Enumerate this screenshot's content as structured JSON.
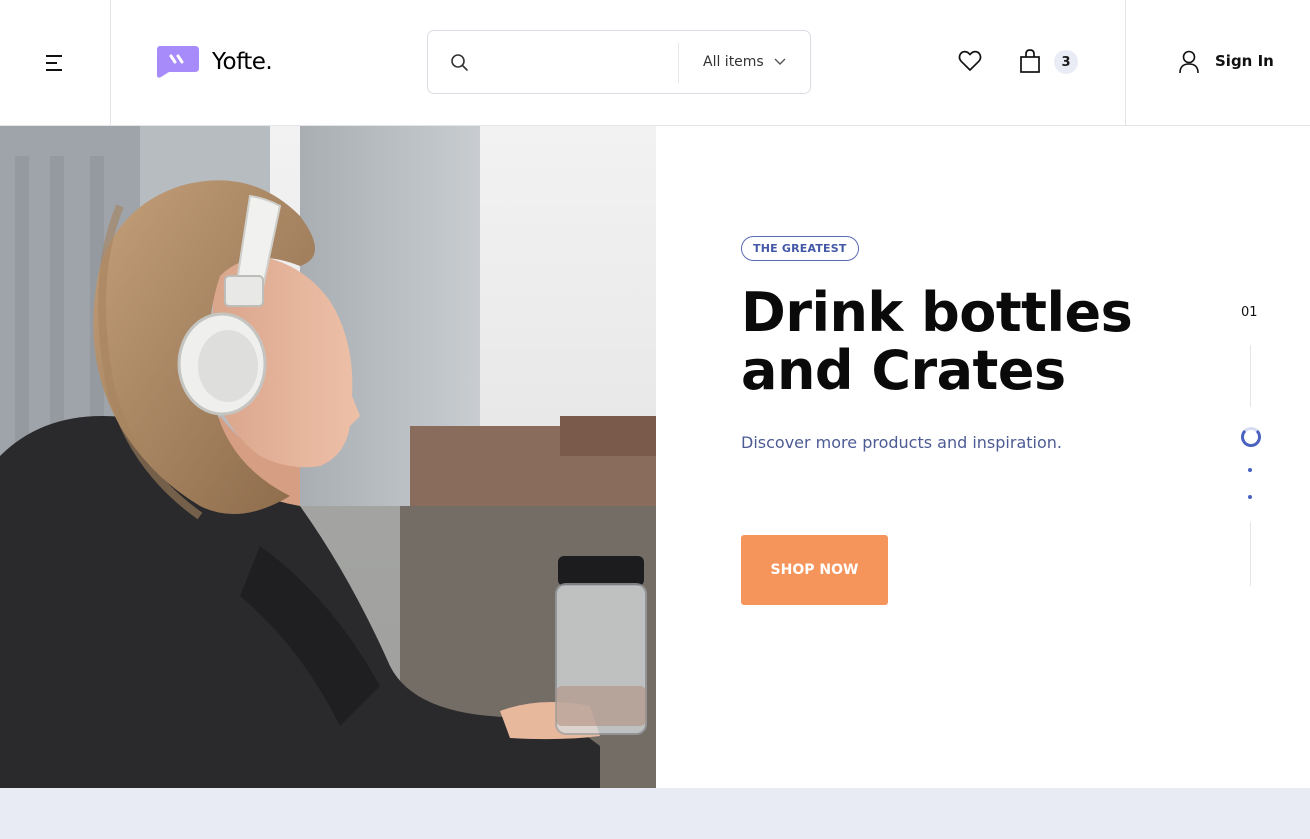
{
  "header": {
    "menu_icon": "hamburger-icon",
    "logo": {
      "text": "Yofte.",
      "color": "#a78bfa"
    },
    "search": {
      "placeholder": "",
      "category": "All items",
      "icon": "search-icon"
    },
    "wishlist_icon": "heart-icon",
    "cart": {
      "icon": "bag-icon",
      "count": "3"
    },
    "signin": {
      "icon": "user-icon",
      "label": "Sign In"
    }
  },
  "hero": {
    "badge": "THE GREATEST",
    "title_line1": "Drink bottles",
    "title_line2": "and Crates",
    "subtitle": "Discover more products and inspiration.",
    "cta": "SHOP NOW",
    "cta_color": "#f5955c",
    "image_subject": "woman with headphones holding water bottle"
  },
  "slider": {
    "current": "01",
    "total_dots": 3,
    "active_index": 0,
    "accent": "#4a61c0"
  }
}
